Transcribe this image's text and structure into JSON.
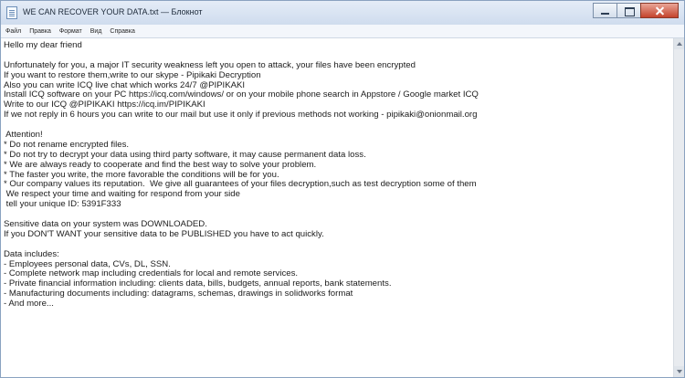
{
  "window": {
    "title": "WE CAN RECOVER YOUR DATA.txt — Блокнот"
  },
  "menu": {
    "items": [
      "Файл",
      "Правка",
      "Формат",
      "Вид",
      "Справка"
    ]
  },
  "document": {
    "lines": [
      "Hello my dear friend",
      "",
      "Unfortunately for you, a major IT security weakness left you open to attack, your files have been encrypted",
      "If you want to restore them,write to our skype - Pipikaki Decryption",
      "Also you can write ICQ live chat which works 24/7 @PIPIKAKI",
      "Install ICQ software on your PC https://icq.com/windows/ or on your mobile phone search in Appstore / Google market ICQ",
      "Write to our ICQ @PIPIKAKI https://icq.im/PIPIKAKI",
      "If we not reply in 6 hours you can write to our mail but use it only if previous methods not working - pipikaki@onionmail.org",
      "",
      " Attention!",
      "* Do not rename encrypted files.",
      "* Do not try to decrypt your data using third party software, it may cause permanent data loss.",
      "* We are always ready to cooperate and find the best way to solve your problem.",
      "* The faster you write, the more favorable the conditions will be for you.",
      "* Our company values its reputation.  We give all guarantees of your files decryption,such as test decryption some of them",
      " We respect your time and waiting for respond from your side",
      " tell your unique ID: 5391F333",
      "",
      "Sensitive data on your system was DOWNLOADED.",
      "If you DON'T WANT your sensitive data to be PUBLISHED you have to act quickly.",
      "",
      "Data includes:",
      "- Employees personal data, CVs, DL, SSN.",
      "- Complete network map including credentials for local and remote services.",
      "- Private financial information including: clients data, bills, budgets, annual reports, bank statements.",
      "- Manufacturing documents including: datagrams, schemas, drawings in solidworks format",
      "- And more..."
    ]
  },
  "icons": {
    "app": "notepad-icon",
    "minimize": "minimize-icon",
    "maximize": "maximize-icon",
    "close": "close-icon"
  }
}
